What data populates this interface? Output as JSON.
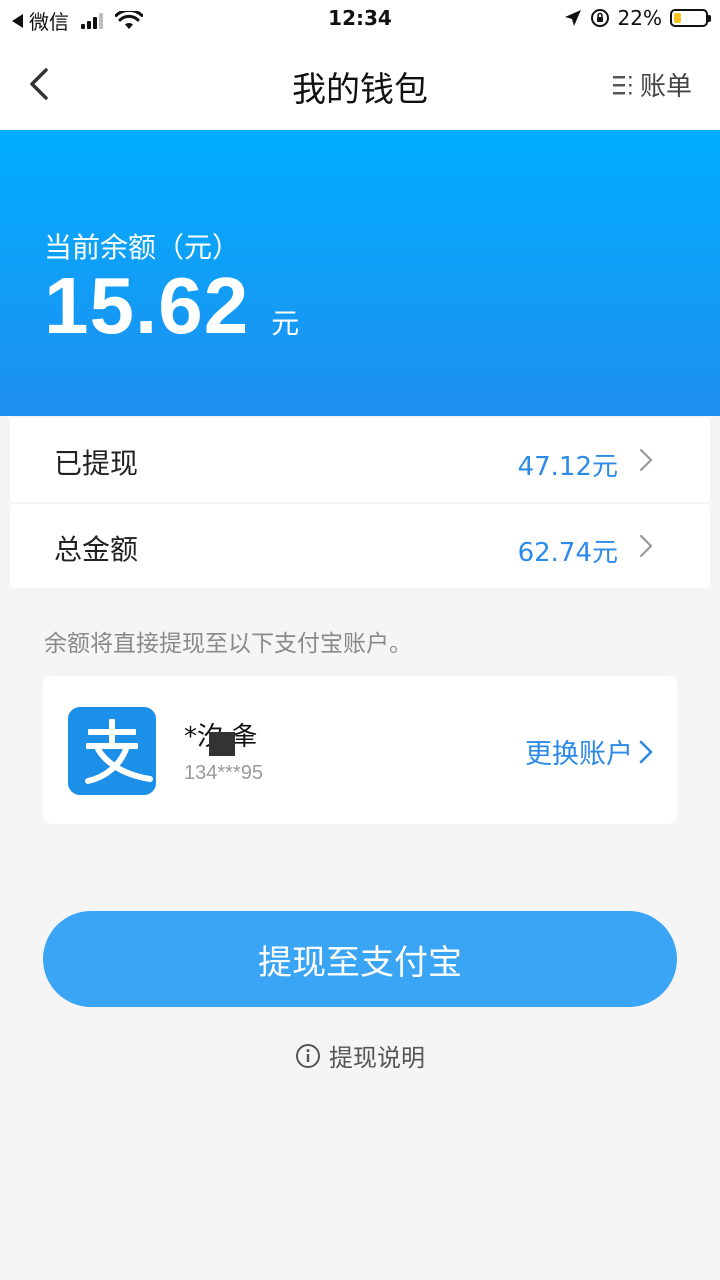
{
  "status_bar": {
    "back_app": "微信",
    "time": "12:34",
    "battery_percent": "22%",
    "battery_level": 0.22,
    "battery_color": "#f7c520"
  },
  "nav": {
    "title": "我的钱包",
    "bill_label": "账单",
    "back_icon": "chevron-left-icon",
    "bill_icon": "list-icon"
  },
  "balance": {
    "label": "当前余额（元）",
    "amount": "15.62",
    "unit": "元",
    "gradient_start": "#00aefe",
    "gradient_end": "#1f8ff0"
  },
  "rows": [
    {
      "label": "已提现",
      "value": "47.12元"
    },
    {
      "label": "总金额",
      "value": "62.74元"
    }
  ],
  "hint": "余额将直接提现至以下支付宝账户。",
  "account": {
    "logo_glyph": "支",
    "name": "*汐 夆",
    "phone": "134***95",
    "change_label": "更换账户"
  },
  "withdraw_button": "提现至支付宝",
  "withdraw_info": "提现说明",
  "colors": {
    "accent": "#2c8be8",
    "button": "#3aa4f5",
    "background": "#f5f5f5"
  }
}
